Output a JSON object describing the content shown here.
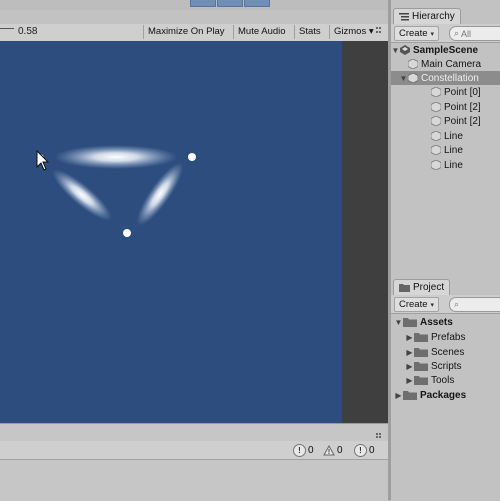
{
  "game_view": {
    "scale_value": "0.58",
    "buttons": [
      "Maximize On Play",
      "Mute Audio",
      "Stats",
      "Gizmos"
    ],
    "gizmos_arrow": "▾",
    "background_color": "#2c4d7e"
  },
  "hierarchy": {
    "tab_label": "Hierarchy",
    "create_label": "Create",
    "search_placeholder": "All",
    "scene_name": "SampleScene",
    "items": [
      {
        "label": "Main Camera"
      },
      {
        "label": "Constellation"
      },
      {
        "label": "Point [0]"
      },
      {
        "label": "Point [2]"
      },
      {
        "label": "Point [2]"
      },
      {
        "label": "Line"
      },
      {
        "label": "Line"
      },
      {
        "label": "Line"
      }
    ]
  },
  "project": {
    "tab_label": "Project",
    "create_label": "Create",
    "folders": {
      "assets": "Assets",
      "children": [
        "Prefabs",
        "Scenes",
        "Scripts",
        "Tools"
      ],
      "packages": "Packages"
    }
  },
  "console": {
    "counts": [
      "0",
      "0",
      "0"
    ]
  },
  "icons": {
    "dropdown_arrow": "▾",
    "expand_arrow": "▶",
    "collapse_arrow": "▼"
  }
}
